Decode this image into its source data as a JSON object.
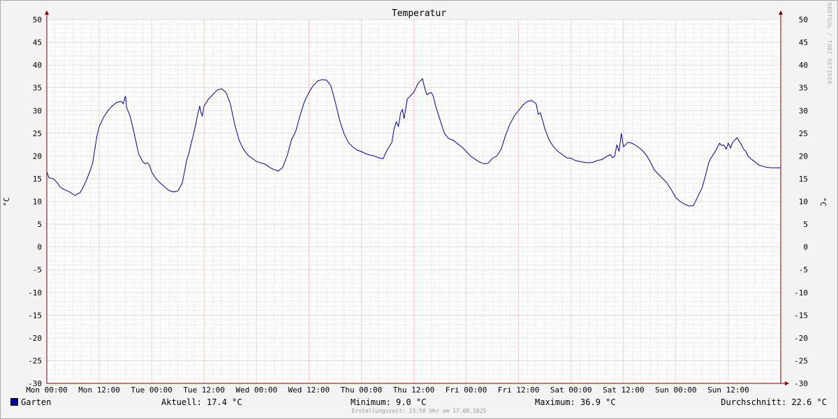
{
  "chart_data": {
    "type": "line",
    "title": "Temperatur",
    "ylabel": "°C",
    "ylabel_right": "°C",
    "ylim": [
      -30,
      50
    ],
    "y_ticks": [
      50,
      45,
      40,
      35,
      30,
      25,
      20,
      15,
      10,
      5,
      0,
      -5,
      -10,
      -15,
      -20,
      -25,
      -30
    ],
    "x_range_hours": [
      0,
      168
    ],
    "x_ticks": [
      {
        "hour": 0,
        "label": "Mon 00:00"
      },
      {
        "hour": 12,
        "label": "Mon 12:00"
      },
      {
        "hour": 24,
        "label": "Tue 00:00"
      },
      {
        "hour": 36,
        "label": "Tue 12:00"
      },
      {
        "hour": 48,
        "label": "Wed 00:00"
      },
      {
        "hour": 60,
        "label": "Wed 12:00"
      },
      {
        "hour": 72,
        "label": "Thu 00:00"
      },
      {
        "hour": 84,
        "label": "Thu 12:00"
      },
      {
        "hour": 96,
        "label": "Fri 00:00"
      },
      {
        "hour": 108,
        "label": "Fri 12:00"
      },
      {
        "hour": 120,
        "label": "Sat 00:00"
      },
      {
        "hour": 132,
        "label": "Sat 12:00"
      },
      {
        "hour": 144,
        "label": "Sun 00:00"
      },
      {
        "hour": 156,
        "label": "Sun 12:00"
      }
    ],
    "grid": true,
    "series": [
      {
        "name": "Garten",
        "color": "#0000a0",
        "points": [
          [
            0,
            16.5
          ],
          [
            0.5,
            15.2
          ],
          [
            1.5,
            15.0
          ],
          [
            2.5,
            14.0
          ],
          [
            3,
            13.2
          ],
          [
            4,
            12.6
          ],
          [
            5,
            12.2
          ],
          [
            6,
            11.6
          ],
          [
            6.5,
            11.3
          ],
          [
            7,
            11.7
          ],
          [
            7.5,
            11.8
          ],
          [
            8,
            12.5
          ],
          [
            9,
            14.5
          ],
          [
            10,
            17.0
          ],
          [
            10.5,
            18.5
          ],
          [
            11,
            21.5
          ],
          [
            11.5,
            24.5
          ],
          [
            12,
            26.5
          ],
          [
            13,
            28.5
          ],
          [
            14,
            30.0
          ],
          [
            15,
            31.0
          ],
          [
            16,
            31.8
          ],
          [
            17,
            32.0
          ],
          [
            17.5,
            31.5
          ],
          [
            18,
            33.2
          ],
          [
            18.3,
            30.5
          ],
          [
            19,
            29.0
          ],
          [
            20,
            25.0
          ],
          [
            21,
            20.5
          ],
          [
            22,
            18.7
          ],
          [
            22.5,
            18.3
          ],
          [
            23,
            18.5
          ],
          [
            23.5,
            18.0
          ],
          [
            24,
            16.5
          ],
          [
            25,
            15.0
          ],
          [
            26,
            14.0
          ],
          [
            27,
            13.2
          ],
          [
            28,
            12.4
          ],
          [
            29,
            12.1
          ],
          [
            30,
            12.3
          ],
          [
            31,
            14.0
          ],
          [
            31.5,
            16.5
          ],
          [
            32,
            19.0
          ],
          [
            32.5,
            20.5
          ],
          [
            33,
            22.5
          ],
          [
            34,
            26.5
          ],
          [
            34.5,
            29.0
          ],
          [
            35,
            31.0
          ],
          [
            35.3,
            29.5
          ],
          [
            35.6,
            28.8
          ],
          [
            36,
            31.0
          ],
          [
            37,
            32.5
          ],
          [
            38,
            33.5
          ],
          [
            39,
            34.5
          ],
          [
            40,
            34.8
          ],
          [
            41,
            34.0
          ],
          [
            42,
            31.5
          ],
          [
            43,
            27.0
          ],
          [
            44,
            23.5
          ],
          [
            45,
            21.5
          ],
          [
            46,
            20.2
          ],
          [
            47,
            19.5
          ],
          [
            48,
            18.8
          ],
          [
            49,
            18.5
          ],
          [
            50,
            18.2
          ],
          [
            51,
            17.5
          ],
          [
            52,
            17.0
          ],
          [
            53,
            16.7
          ],
          [
            54,
            17.5
          ],
          [
            55,
            20.0
          ],
          [
            56,
            23.5
          ],
          [
            57,
            25.5
          ],
          [
            58,
            29.0
          ],
          [
            59,
            32.0
          ],
          [
            60,
            34.0
          ],
          [
            61,
            35.5
          ],
          [
            62,
            36.5
          ],
          [
            63,
            36.8
          ],
          [
            64,
            36.7
          ],
          [
            65,
            35.5
          ],
          [
            66,
            32.0
          ],
          [
            67,
            28.0
          ],
          [
            68,
            25.0
          ],
          [
            69,
            23.0
          ],
          [
            70,
            22.0
          ],
          [
            71,
            21.3
          ],
          [
            72,
            21.0
          ],
          [
            73,
            20.5
          ],
          [
            74,
            20.2
          ],
          [
            75,
            20.0
          ],
          [
            76,
            19.6
          ],
          [
            77,
            19.4
          ],
          [
            77.5,
            20.5
          ],
          [
            78,
            21.5
          ],
          [
            79,
            23.0
          ],
          [
            79.5,
            26.0
          ],
          [
            80,
            27.5
          ],
          [
            80.5,
            26.5
          ],
          [
            81,
            29.5
          ],
          [
            81.4,
            30.2
          ],
          [
            81.8,
            28.2
          ],
          [
            82.5,
            32.5
          ],
          [
            83,
            33.0
          ],
          [
            84,
            34.0
          ],
          [
            85,
            36.0
          ],
          [
            85.5,
            36.5
          ],
          [
            86,
            37.0
          ],
          [
            86.5,
            35.0
          ],
          [
            87,
            33.5
          ],
          [
            88,
            34.0
          ],
          [
            88.5,
            33.0
          ],
          [
            89,
            31.0
          ],
          [
            90,
            28.0
          ],
          [
            91,
            25.0
          ],
          [
            92,
            23.8
          ],
          [
            93,
            23.5
          ],
          [
            94,
            22.7
          ],
          [
            95,
            22.0
          ],
          [
            96,
            21.0
          ],
          [
            97,
            20.0
          ],
          [
            98,
            19.3
          ],
          [
            99,
            18.7
          ],
          [
            100,
            18.3
          ],
          [
            101,
            18.4
          ],
          [
            102,
            19.5
          ],
          [
            103,
            20.0
          ],
          [
            104,
            21.5
          ],
          [
            105,
            24.5
          ],
          [
            106,
            27.0
          ],
          [
            107,
            28.8
          ],
          [
            108,
            30.0
          ],
          [
            109,
            31.2
          ],
          [
            110,
            32.0
          ],
          [
            111,
            32.2
          ],
          [
            112,
            31.5
          ],
          [
            112.5,
            29.2
          ],
          [
            113,
            29.5
          ],
          [
            114,
            26.0
          ],
          [
            115,
            23.5
          ],
          [
            116,
            22.0
          ],
          [
            117,
            21.0
          ],
          [
            118,
            20.3
          ],
          [
            119,
            19.6
          ],
          [
            120,
            19.5
          ],
          [
            121,
            19.0
          ],
          [
            122,
            18.8
          ],
          [
            123,
            18.6
          ],
          [
            124,
            18.5
          ],
          [
            125,
            18.6
          ],
          [
            126,
            19.0
          ],
          [
            127,
            19.2
          ],
          [
            128,
            19.8
          ],
          [
            129,
            20.3
          ],
          [
            129.5,
            19.6
          ],
          [
            130,
            20.0
          ],
          [
            130.5,
            22.5
          ],
          [
            131,
            21.0
          ],
          [
            131.5,
            25.0
          ],
          [
            132,
            22.0
          ],
          [
            133,
            23.0
          ],
          [
            134,
            22.8
          ],
          [
            135,
            22.2
          ],
          [
            136,
            21.5
          ],
          [
            137,
            20.5
          ],
          [
            138,
            19.0
          ],
          [
            139,
            17.0
          ],
          [
            140,
            16.0
          ],
          [
            141,
            15.0
          ],
          [
            142,
            14.0
          ],
          [
            143,
            12.5
          ],
          [
            144,
            10.8
          ],
          [
            145,
            10.0
          ],
          [
            146,
            9.4
          ],
          [
            147,
            9.0
          ],
          [
            148,
            9.1
          ],
          [
            149,
            11.0
          ],
          [
            150,
            13.0
          ],
          [
            151,
            16.5
          ],
          [
            151.5,
            18.5
          ],
          [
            152,
            19.5
          ],
          [
            153,
            21.0
          ],
          [
            154,
            22.8
          ],
          [
            154.5,
            22.3
          ],
          [
            155,
            22.4
          ],
          [
            155.5,
            21.5
          ],
          [
            156,
            22.8
          ],
          [
            156.5,
            21.8
          ],
          [
            157,
            23.0
          ],
          [
            158,
            24.0
          ],
          [
            159,
            22.5
          ],
          [
            159.5,
            21.5
          ],
          [
            160,
            21.0
          ],
          [
            160.5,
            20.0
          ],
          [
            161,
            19.5
          ],
          [
            162,
            18.8
          ],
          [
            163,
            18.0
          ],
          [
            164,
            17.7
          ],
          [
            165,
            17.5
          ],
          [
            166,
            17.4
          ],
          [
            168,
            17.4
          ]
        ]
      }
    ]
  },
  "legend": {
    "series_name": "Garten",
    "current": "Aktuell: 17.4 °C",
    "minimum": "Minimum: 9.0 °C",
    "maximum": "Maximum: 36.9 °C",
    "average": "Durchschnitt: 22.6 °C"
  },
  "footer": "Erstellungszeit: 23:58 Uhr am 17.08.2025",
  "watermark": "RRDTOOL / TOBI OETIKER",
  "colors": {
    "line": "#0000a0",
    "major_grid": "#e08080",
    "minor_grid": "#c8c8c8",
    "axis": "#800000"
  }
}
